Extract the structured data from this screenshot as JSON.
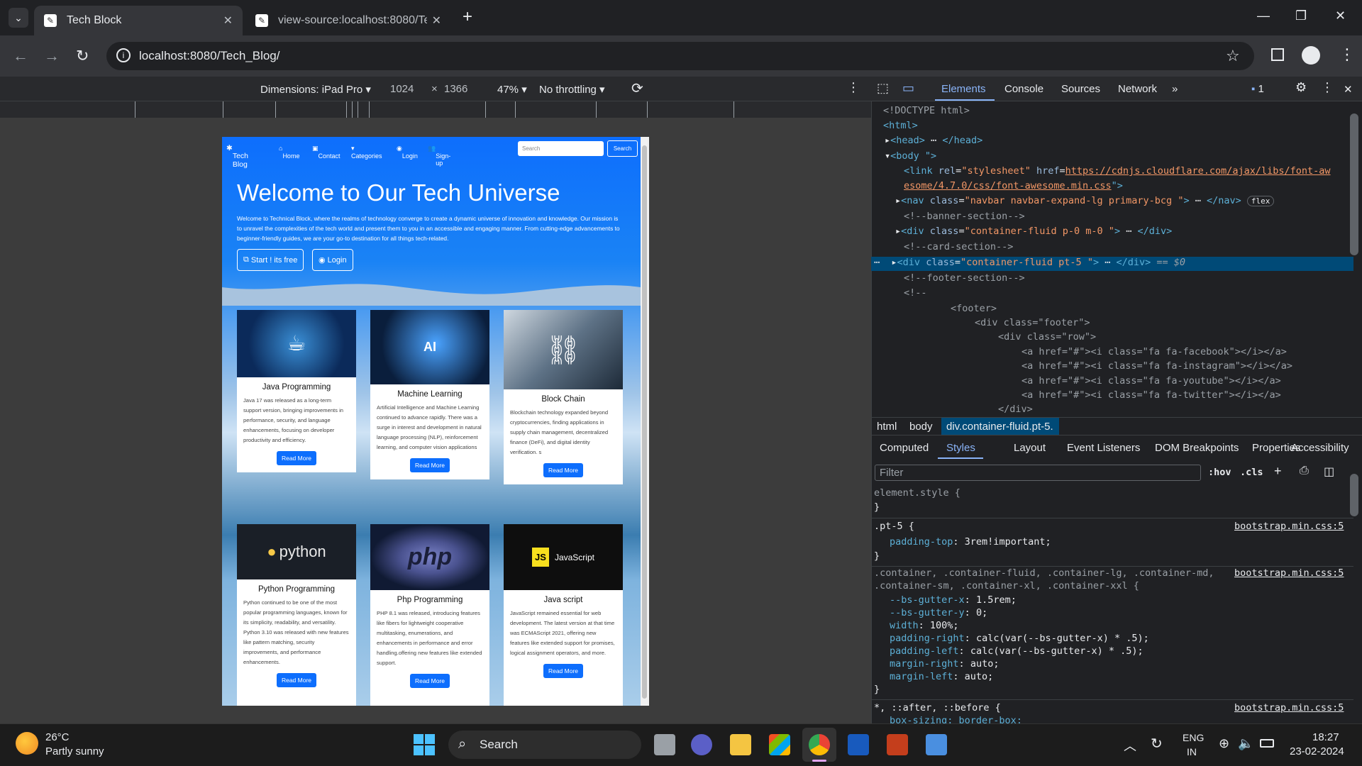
{
  "browser": {
    "tabs": [
      {
        "title": "Tech Block",
        "active": true
      },
      {
        "title": "view-source:localhost:8080/Tec",
        "active": false
      }
    ],
    "new_tab": "+",
    "url": "localhost:8080/Tech_Blog/"
  },
  "device_toolbar": {
    "dimensions_label": "Dimensions: iPad Pro",
    "width": "1024",
    "times": "×",
    "height": "1366",
    "zoom": "47%",
    "throttle": "No throttling"
  },
  "site": {
    "brand": "Tech Blog",
    "nav": [
      "Home",
      "Contact",
      "Categories",
      "Login",
      "Sign-up"
    ],
    "search_placeholder": "Search",
    "search_button": "Search",
    "hero_title": "Welcome to Our Tech Universe",
    "hero_text": "Welcome to Technical Block, where the realms of technology converge to create a dynamic universe of innovation and knowledge. Our mission is to unravel the complexities of the tech world and present them to you in an accessible and engaging manner. From cutting-edge advancements to beginner-friendly guides, we are your go-to destination for all things tech-related.",
    "hero_btn_start": "Start ! its free",
    "hero_btn_login": "Login",
    "cards": [
      {
        "title": "Java Programming",
        "text": "Java 17 was released as a long-term support version, bringing improvements in performance, security, and language enhancements, focusing on developer productivity and efficiency.",
        "button": "Read More"
      },
      {
        "title": "Machine Learning",
        "text": "Artificial Intelligence and Machine Learning continued to advance rapidly. There was a surge in interest and development in natural language processing (NLP), reinforcement learning, and computer vision applications",
        "button": "Read More"
      },
      {
        "title": "Block Chain",
        "text": "Blockchain technology expanded beyond cryptocurrencies, finding applications in supply chain management, decentralized finance (DeFi), and digital identity verification. s",
        "button": "Read More"
      },
      {
        "title": "Python Programming",
        "text": "Python continued to be one of the most popular programming languages, known for its simplicity, readability, and versatility. Python 3.10 was released with new features like pattern matching, security improvements, and performance enhancements.",
        "button": "Read More"
      },
      {
        "title": "Php Programming",
        "text": "PHP 8.1 was released, introducing features like fibers for lightweight cooperative multitasking, enumerations, and enhancements in performance and error handling.offering new features like extended support.",
        "button": "Read More"
      },
      {
        "title": "Java script",
        "text": "JavaScript remained essential for web development. The latest version at that time was ECMAScript 2021, offering new features like extended support for promises, logical assignment operators, and more.",
        "button": "Read More"
      }
    ],
    "card_images": {
      "java": "",
      "ml": "AI",
      "python": "python",
      "php": "php",
      "js": "JavaScript",
      "js_badge": "JS"
    }
  },
  "devtools": {
    "tabs": [
      "Elements",
      "Console",
      "Sources",
      "Network"
    ],
    "issues_count": "1",
    "dom": {
      "doctype": "<!DOCTYPE html>",
      "html_open": "<html>",
      "head": "<head>",
      "head_close": "</head>",
      "body": "<body \">",
      "link_line1": "https://cdnjs.cloudflare.com/ajax/libs/font-aw",
      "link_line2": "esome/4.7.0/css/font-awesome.min.css",
      "nav_class": "navbar navbar-expand-lg primary-bcg ",
      "flex_badge": "flex",
      "banner_comment": "<!--banner-section-->",
      "div1_class": "container-fluid p-0 m-0 ",
      "card_comment": "<!--card-section-->",
      "div2_class": "container-fluid pt-5 ",
      "eq": "== $0",
      "footer_comment": "<!--footer-section-->",
      "comment_open": "<!--",
      "footer_lines": [
        "<footer>",
        "<div class=\"footer\">",
        "<div class=\"row\">",
        "<a href=\"#\"><i class=\"fa fa-facebook\"></i></a>",
        "<a href=\"#\"><i class=\"fa fa-instagram\"></i></a>",
        "<a href=\"#\"><i class=\"fa fa-youtube\"></i></a>",
        "<a href=\"#\"><i class=\"fa fa-twitter\"></i></a>",
        "</div>"
      ]
    },
    "breadcrumbs": [
      "html",
      "body",
      "div.container-fluid.pt-5."
    ],
    "subtabs": [
      "Computed",
      "Styles",
      "Layout",
      "Event Listeners",
      "DOM Breakpoints",
      "Properties",
      "Accessibility"
    ],
    "filter_placeholder": "Filter",
    "hov": ":hov",
    "cls": ".cls",
    "styles": {
      "element_style": "element.style {",
      "pt5_selector": ".pt-5 {",
      "pt5_prop": "padding-top",
      "pt5_val": "3rem!important;",
      "source": "bootstrap.min.css:5",
      "container_sel1": ".container, .container-fluid, .container-lg, .container-md,",
      "container_sel2": ".container-sm, .container-xl, .container-xxl {",
      "container_props": [
        [
          "--bs-gutter-x",
          "1.5rem;"
        ],
        [
          "--bs-gutter-y",
          "0;"
        ],
        [
          "width",
          "100%;"
        ],
        [
          "padding-right",
          "calc(var(--bs-gutter-x) * .5);"
        ],
        [
          "padding-left",
          "calc(var(--bs-gutter-x) * .5);"
        ],
        [
          "margin-right",
          "auto;"
        ],
        [
          "margin-left",
          "auto;"
        ]
      ],
      "universal_sel": "*, ::after, ::before {",
      "universal_prop": "box-sizing: border-box;"
    }
  },
  "taskbar": {
    "weather_temp": "26°C",
    "weather_desc": "Partly sunny",
    "search": "Search",
    "lang1": "ENG",
    "lang2": "IN",
    "time": "18:27",
    "date": "23-02-2024"
  }
}
